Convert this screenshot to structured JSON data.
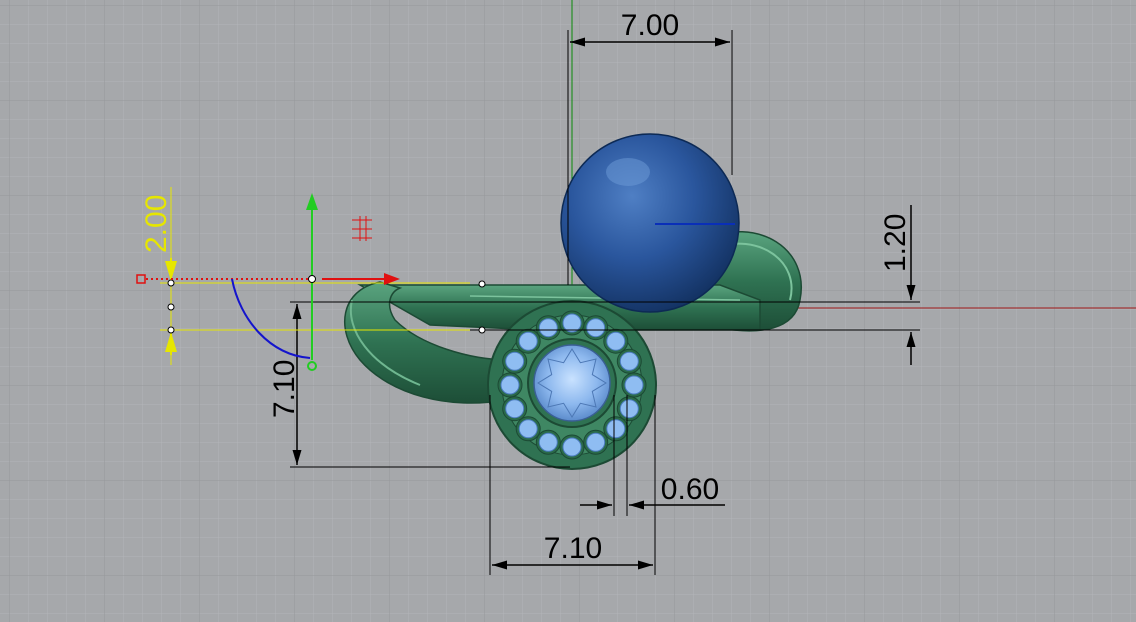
{
  "viewport": {
    "background": "#a6a8ab",
    "grid_minor": "#b0b2b5",
    "grid_major": "#97999c",
    "axis_x_color": "#a01818",
    "axis_y_color": "#0a7a0a"
  },
  "dimensions": {
    "top_width": "7.00",
    "right_height": "1.20",
    "left_height": "7.10",
    "bottom_width": "7.10",
    "bottom_small": "0.60",
    "gumball_height": "2.00"
  },
  "colors": {
    "ring": "#2c6e4d",
    "ring_light": "#4d9b72",
    "pearl": "#1f4a8e",
    "gem": "#8bb8f0",
    "dimension": "#000000",
    "gumball_dim": "#e6e600"
  },
  "icons": {
    "gumball_x_arrow": "arrow-right",
    "gumball_y_arrow": "arrow-up",
    "gumball_scale_handle": "square",
    "gumball_rotate_arc": "arc"
  }
}
